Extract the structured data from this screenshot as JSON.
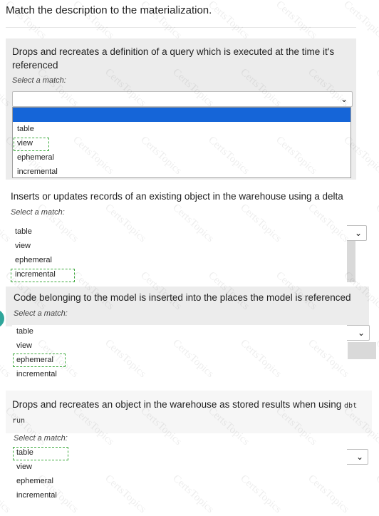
{
  "title": "Match the description to the materialization.",
  "watermark": "CertsTopics",
  "select_hint": "Select a match:",
  "questions": [
    {
      "text": "Drops and recreates a definition of a query which is executed at the time it's referenced",
      "options": [
        "table",
        "view",
        "ephemeral",
        "incremental"
      ],
      "marked": "view"
    },
    {
      "text": "Inserts or updates records of an existing object in the warehouse using a delta",
      "options": [
        "table",
        "view",
        "ephemeral",
        "incremental"
      ],
      "marked": "incremental"
    },
    {
      "text": "Code belonging to the model is inserted into the places the model is referenced",
      "options": [
        "table",
        "view",
        "ephemeral",
        "incremental"
      ],
      "marked": "ephemeral"
    },
    {
      "text": "Drops and recreates an object in the warehouse as stored results when using",
      "code": "dbt run",
      "options": [
        "table",
        "view",
        "ephemeral",
        "incremental"
      ],
      "marked": "table"
    }
  ]
}
